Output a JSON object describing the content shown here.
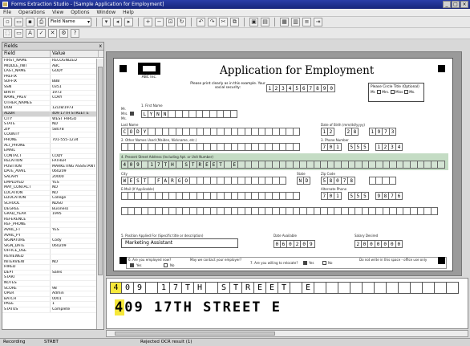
{
  "window": {
    "title": "Forms Extraction Studio - [Sample Application for Employment]"
  },
  "menu": [
    "File",
    "Operations",
    "View",
    "Options",
    "Window",
    "Help"
  ],
  "toolbar": {
    "field_select": "Field Name"
  },
  "left_panel": {
    "title": "Fields",
    "close": "x",
    "col_field": "Field",
    "col_value": "Value",
    "rows": [
      [
        "FIRST_NAME",
        "RECOGNIZED"
      ],
      [
        "MIDDLE_INIT",
        "ABC"
      ],
      [
        "LAST_NAME",
        "GODY"
      ],
      [
        "PREFIX",
        ""
      ],
      [
        "SUFFIX",
        "BBB"
      ],
      [
        "SSN",
        "0351"
      ],
      [
        "BIRTH",
        "1973"
      ],
      [
        "NAME_PREV",
        "CORY"
      ],
      [
        "OTHER_NAMES",
        ""
      ],
      [
        "DOB",
        "12/28/1973"
      ],
      [
        "ADDR",
        "409 17TH STREET E"
      ],
      [
        "CITY",
        "WEST FARGO"
      ],
      [
        "STATE",
        "ND"
      ],
      [
        "ZIP",
        "58078"
      ],
      [
        "COUNTY",
        ""
      ],
      [
        "PHONE",
        "701-555-1234"
      ],
      [
        "ALT_PHONE",
        ""
      ],
      [
        "EMAIL",
        ""
      ],
      [
        "CONTACT",
        "CODY"
      ],
      [
        "RELATION",
        "FATHER"
      ],
      [
        "POSITION",
        "MARKETING ASSISTANT"
      ],
      [
        "DATE_AVAIL",
        "060209"
      ],
      [
        "SALARY",
        "20000"
      ],
      [
        "EMPLOYED",
        "YES"
      ],
      [
        "MAY_CONTACT",
        "NO"
      ],
      [
        "LOCATION",
        "NO"
      ],
      [
        "EDUCATION",
        "College"
      ],
      [
        "SCHOOL",
        "NDSU"
      ],
      [
        "DEGREE",
        "Business"
      ],
      [
        "GRAD_YEAR",
        "1995"
      ],
      [
        "REFERENCE",
        ""
      ],
      [
        "REF_PHONE",
        ""
      ],
      [
        "AVAIL_FT",
        "YES"
      ],
      [
        "AVAIL_PT",
        ""
      ],
      [
        "SIGNATURE",
        "Cody"
      ],
      [
        "SIGN_DATE",
        "060209"
      ],
      [
        "OFFICE_USE",
        ""
      ],
      [
        "REVIEWED",
        ""
      ],
      [
        "INTERVIEW",
        "NO"
      ],
      [
        "HIRED",
        ""
      ],
      [
        "DEPT",
        "Sales"
      ],
      [
        "START",
        ""
      ],
      [
        "NOTES",
        ""
      ],
      [
        "SCORE",
        "98"
      ],
      [
        "OPER",
        "Admin"
      ],
      [
        "BATCH",
        "0001"
      ],
      [
        "PAGE",
        "1"
      ],
      [
        "STATUS",
        "Complete"
      ]
    ]
  },
  "form": {
    "logo_text": "ABC Inc.",
    "title": "Application for Employment",
    "ssn_note": "Please print clearly as in this example. Your social security:",
    "ssn_digits": [
      "1",
      "2",
      "3",
      "4",
      "5",
      "6",
      "7",
      "8",
      "9",
      "0"
    ],
    "choice_title": "Please Circle Title (Optional)",
    "choice_options": [
      "Mr.",
      "Mrs.",
      "Miss",
      "Ms."
    ],
    "title_labels": [
      "Mr.",
      "Mrs.",
      "Ms."
    ],
    "label_first": "1. First Name",
    "first_name": "LYNN",
    "label_last": "Last Name",
    "last_name": "CODY",
    "label_dob": "Date of Birth (mm/dd/yyyy)",
    "dob": [
      "1",
      "2",
      "2",
      "8",
      "1",
      "9",
      "7",
      "3"
    ],
    "label_prev": "2. Other Names Used (Maiden, Nickname, etc.)",
    "label_phone": "3. Phone Number",
    "phone": [
      "7",
      "0",
      "1",
      "5",
      "5",
      "5",
      "1",
      "2",
      "3",
      "4"
    ],
    "label_addr": "4. Present Street Address (Including Apt. or Unit Number)",
    "address": "409 17TH STREET E",
    "label_city": "City",
    "city": "WEST FARGO",
    "label_state": "State",
    "state": "ND",
    "label_zip": "Zip Code",
    "zip": "58078",
    "label_alt": "Alternate Phone",
    "alt_phone": [
      "7",
      "0",
      "1",
      "5",
      "5",
      "5",
      "9",
      "8",
      "7",
      "6"
    ],
    "label_email": "E-Mail (If Applicable)",
    "label_position": "5. Position Applied For (Specific title or description)",
    "position": "Marketing Assistant",
    "label_date_avail": "Date Available",
    "date_avail": [
      "0",
      "6",
      "0",
      "2",
      "0",
      "9"
    ],
    "label_salary": "Salary Desired",
    "salary": [
      "2",
      "0",
      "0",
      "0",
      "0",
      "0",
      "0"
    ],
    "label_employed": "6. Are you employed now?",
    "label_contact": "May we contact your employer?",
    "opt_yes": "Yes",
    "opt_no": "No",
    "label_travel": "7. Are you willing to relocate?",
    "label_office": "Do not write in this space - office use only"
  },
  "zoom": {
    "boxes": [
      "4",
      "0",
      "9",
      "",
      "1",
      "7",
      "T",
      "H",
      "",
      "S",
      "T",
      "R",
      "E",
      "E",
      "T",
      "",
      "E",
      "",
      "",
      "",
      "",
      "",
      "",
      "",
      "",
      "",
      "",
      "",
      ""
    ],
    "text_first": "4",
    "text_rest": "09 17TH STREET E"
  },
  "status": {
    "left": "Recording",
    "mid": "STRBT",
    "right": "Rejected OCR result (1)"
  },
  "colors": {
    "titlebar": "#1e2f90",
    "highlight": "#f6e83a",
    "band": "#c4dcc4"
  }
}
